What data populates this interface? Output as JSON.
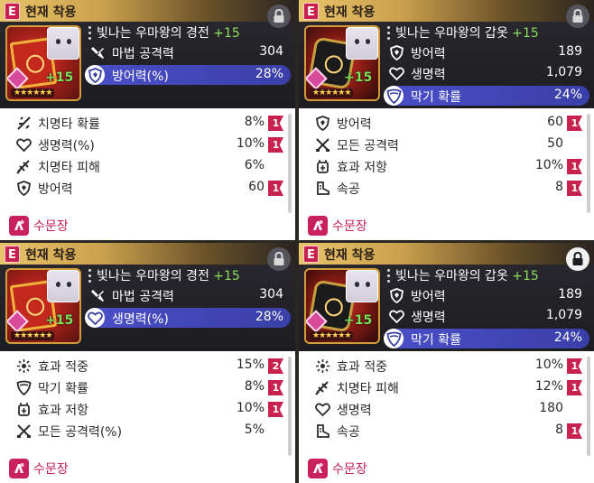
{
  "cards": [
    {
      "equip_badge": "E",
      "equip_label": "현재 착용",
      "item_name": "빛나는 우마왕의 경전",
      "enhance": "+15",
      "thumb_plus": "+15",
      "thumb_stars": "★★★★★★",
      "main_stat": {
        "icon": "attack-icon",
        "label": "마법 공격력",
        "value": "304"
      },
      "sub_stat": {
        "icon": "shield-icon",
        "label": "방어력(%)",
        "value": "28%"
      },
      "stats": [
        {
          "icon": "crit-chance-icon",
          "label": "치명타 확률",
          "value": "8%",
          "flag": "1"
        },
        {
          "icon": "heart-icon",
          "label": "생명력(%)",
          "value": "10%",
          "flag": "1"
        },
        {
          "icon": "crit-damage-icon",
          "label": "치명타 피해",
          "value": "6%",
          "flag": ""
        },
        {
          "icon": "shield-icon",
          "label": "방어력",
          "value": "60",
          "flag": "1"
        }
      ],
      "set_label": "수문장",
      "lock_style": "dark"
    },
    {
      "equip_badge": "E",
      "equip_label": "현재 착용",
      "item_name": "빛나는 우마왕의 갑옷",
      "enhance": "+15",
      "thumb_plus": "+15",
      "thumb_stars": "★★★★★★",
      "main_stat": {
        "icon": "shield-icon",
        "label": "방어력",
        "value": "189"
      },
      "main_stat2": {
        "icon": "heart-icon",
        "label": "생명력",
        "value": "1,079"
      },
      "sub_stat": {
        "icon": "block-icon",
        "label": "막기 확률",
        "value": "24%"
      },
      "stats": [
        {
          "icon": "shield-icon",
          "label": "방어력",
          "value": "60",
          "flag": "1"
        },
        {
          "icon": "attack-all-icon",
          "label": "모든 공격력",
          "value": "50",
          "flag": ""
        },
        {
          "icon": "resist-icon",
          "label": "효과 저항",
          "value": "10%",
          "flag": "1"
        },
        {
          "icon": "speed-icon",
          "label": "속공",
          "value": "8",
          "flag": "1"
        }
      ],
      "set_label": "수문장",
      "lock_style": "dark"
    },
    {
      "equip_badge": "E",
      "equip_label": "현재 착용",
      "item_name": "빛나는 우마왕의 경전",
      "enhance": "+15",
      "thumb_plus": "+15",
      "thumb_stars": "★★★★★★",
      "main_stat": {
        "icon": "attack-icon",
        "label": "마법 공격력",
        "value": "304"
      },
      "sub_stat": {
        "icon": "heart-icon",
        "label": "생명력(%)",
        "value": "28%"
      },
      "stats": [
        {
          "icon": "effect-hit-icon",
          "label": "효과 적중",
          "value": "15%",
          "flag": "2"
        },
        {
          "icon": "block-icon",
          "label": "막기 확률",
          "value": "8%",
          "flag": "1"
        },
        {
          "icon": "resist-icon",
          "label": "효과 저항",
          "value": "10%",
          "flag": "1"
        },
        {
          "icon": "attack-all-icon",
          "label": "모든 공격력(%)",
          "value": "5%",
          "flag": ""
        }
      ],
      "set_label": "수문장",
      "lock_style": "dark"
    },
    {
      "equip_badge": "E",
      "equip_label": "현재 착용",
      "item_name": "빛나는 우마왕의 갑옷",
      "enhance": "+15",
      "thumb_plus": "+15",
      "thumb_stars": "★★★★★★",
      "main_stat": {
        "icon": "shield-icon",
        "label": "방어력",
        "value": "189"
      },
      "main_stat2": {
        "icon": "heart-icon",
        "label": "생명력",
        "value": "1,079"
      },
      "sub_stat": {
        "icon": "block-icon",
        "label": "막기 확률",
        "value": "24%"
      },
      "stats": [
        {
          "icon": "effect-hit-icon",
          "label": "효과 적중",
          "value": "10%",
          "flag": "1"
        },
        {
          "icon": "crit-damage-icon",
          "label": "치명타 피해",
          "value": "12%",
          "flag": "1"
        },
        {
          "icon": "heart-icon",
          "label": "생명력",
          "value": "180",
          "flag": ""
        },
        {
          "icon": "speed-icon",
          "label": "속공",
          "value": "8",
          "flag": "1"
        }
      ],
      "set_label": "수문장",
      "lock_style": "light"
    }
  ],
  "colors": {
    "accent": "#c8214e",
    "substat_bar": "#4b4fc8",
    "enhance_green": "#8be05c",
    "set_text": "#c31f52"
  }
}
